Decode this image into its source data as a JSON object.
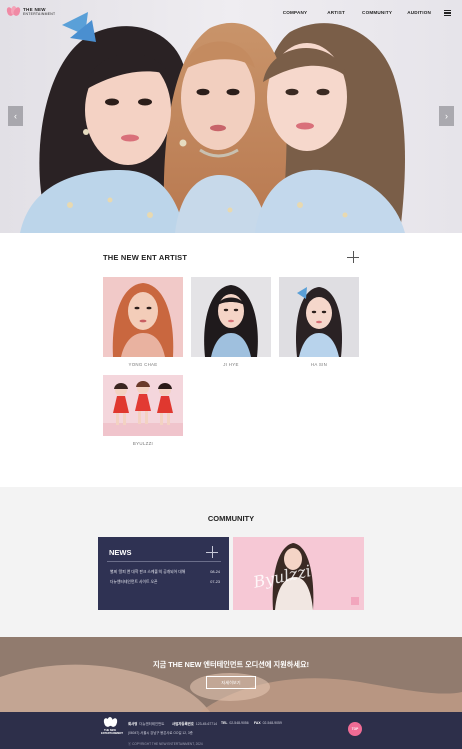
{
  "header": {
    "logo_line1": "THE NEW",
    "logo_line2": "ENTERTAINMENT",
    "nav": [
      "COMPANY",
      "ARTIST",
      "COMMUNITY",
      "AUDITION"
    ]
  },
  "artists": {
    "title": "THE NEW ENT ARTIST",
    "items": [
      {
        "name": "YONG CHAE"
      },
      {
        "name": "JI HYE"
      },
      {
        "name": "HA SIN"
      },
      {
        "name": "BYULZZI"
      }
    ]
  },
  "community": {
    "title": "COMMUNITY",
    "news_title": "NEWS",
    "news": [
      {
        "text": "별찌 '알피 앤 대학 판크 스케줄'의 공개되어 대해",
        "date": "08-24"
      },
      {
        "text": "더뉴엔터테인먼트 사이트 오픈",
        "date": "07-23"
      }
    ],
    "promo_text": "Byulzzi"
  },
  "banner": {
    "headline": "지금 THE NEW 엔터테인먼트 오디션에 지원하세요!",
    "button": "자세히보기"
  },
  "footer": {
    "logo_text": "THE NEW ENTERTAINMENT",
    "company_label": "회사명",
    "company_value": "더뉴엔터테인먼트",
    "biz_label": "사업자등록번호",
    "biz_value": "123-45-67714",
    "tel_label": "TEL",
    "tel_value": "02-548-9056",
    "fax_label": "FAX",
    "fax_value": "02-548-9059",
    "address": "(06047) 서울시 강남구 봉은사로 OO길 12, 3층",
    "copyright": "ⓒ COPYRIGHT THE NEW ENTERTAINMENT, 2024",
    "top_label": "TOP"
  },
  "colors": {
    "navy": "#2f3253",
    "pink": "#f06c95",
    "community_bg": "#f3f3f3"
  }
}
